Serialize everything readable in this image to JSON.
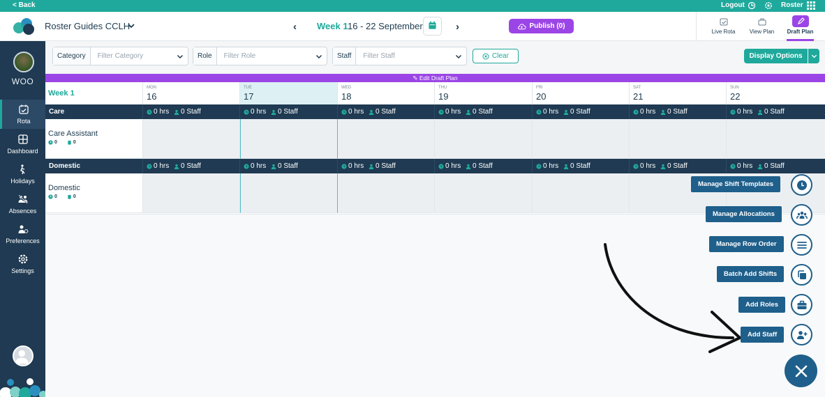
{
  "topbar": {
    "back": "< Back",
    "logout": "Logout",
    "roster": "Roster",
    "logout_icon": "logout-icon",
    "settings_icon": "gear-icon",
    "apps_icon": "grid-icon"
  },
  "header": {
    "org_name": "Roster Guides CCLH",
    "week_label": "Week 1",
    "week_range": "16 - 22 September",
    "publish": "Publish (0)",
    "view_tabs": [
      {
        "label": "Live Rota",
        "icon": "calendar-check-icon"
      },
      {
        "label": "View Plan",
        "icon": "briefcase-icon"
      },
      {
        "label": "Draft Plan",
        "icon": "pencil-icon",
        "active": true
      }
    ]
  },
  "sidebar": {
    "org_code": "WOO",
    "items": [
      {
        "label": "Rota",
        "icon": "calendar-icon",
        "active": true
      },
      {
        "label": "Dashboard",
        "icon": "dashboard-icon"
      },
      {
        "label": "Holidays",
        "icon": "holiday-icon"
      },
      {
        "label": "Absences",
        "icon": "absence-icon"
      },
      {
        "label": "Preferences",
        "icon": "preferences-icon"
      },
      {
        "label": "Settings",
        "icon": "gear-icon"
      }
    ]
  },
  "filters": {
    "category_label": "Category",
    "category_placeholder": "Filter Category",
    "role_label": "Role",
    "role_placeholder": "Filter Role",
    "staff_label": "Staff",
    "staff_placeholder": "Filter Staff",
    "clear": "Clear",
    "display_options": "Display Options"
  },
  "draft_bar": "Edit Draft Plan",
  "grid": {
    "week_label": "Week 1",
    "days": [
      {
        "dow": "MON",
        "num": "16"
      },
      {
        "dow": "TUE",
        "num": "17",
        "today": true
      },
      {
        "dow": "WED",
        "num": "18"
      },
      {
        "dow": "THU",
        "num": "19"
      },
      {
        "dow": "FRI",
        "num": "20"
      },
      {
        "dow": "SAT",
        "num": "21"
      },
      {
        "dow": "SUN",
        "num": "22"
      }
    ],
    "cell_hours": "0 hrs",
    "cell_staff": "0 Staff",
    "groups": [
      {
        "name": "Care",
        "role": "Care Assistant",
        "hrs_count": "0",
        "staff_count": "0"
      },
      {
        "name": "Domestic",
        "role": "Domestic",
        "hrs_count": "0",
        "staff_count": "0"
      }
    ]
  },
  "fab_menu": [
    {
      "label": "Manage Shift Templates",
      "icon": "clock-icon"
    },
    {
      "label": "Manage Allocations",
      "icon": "people-icon"
    },
    {
      "label": "Manage Row Order",
      "icon": "list-icon"
    },
    {
      "label": "Batch Add Shifts",
      "icon": "copy-icon"
    },
    {
      "label": "Add Roles",
      "icon": "briefcase-icon"
    },
    {
      "label": "Add Staff",
      "icon": "add-user-icon"
    }
  ],
  "colors": {
    "teal": "#1fa99c",
    "navy": "#1f3a52",
    "purple": "#9b45e6",
    "fab_blue": "#1f5f8b"
  }
}
